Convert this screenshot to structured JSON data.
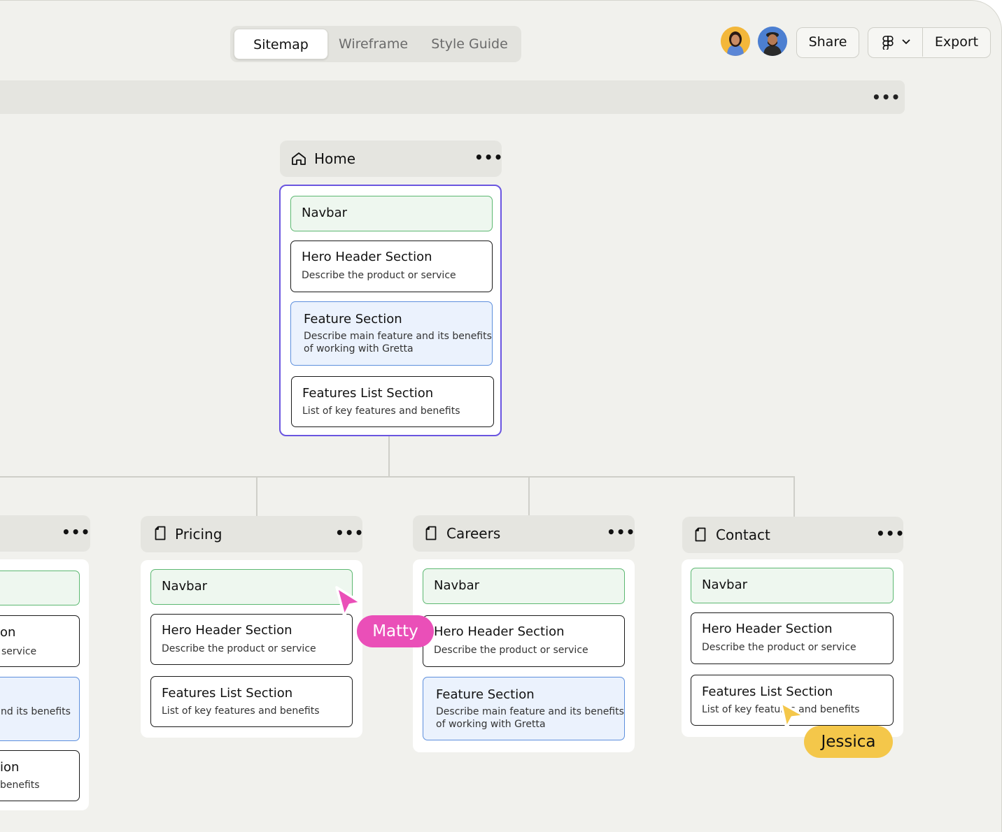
{
  "tabs": [
    "Sitemap",
    "Wireframe",
    "Style Guide"
  ],
  "header": {
    "share": "Share",
    "export": "Export"
  },
  "icons": {
    "home": "home-icon",
    "page": "page-icon",
    "figma": "figma-icon",
    "chevron": "chevron-down-icon",
    "more": "more-horizontal-icon"
  },
  "colors": {
    "navbar_border": "#5cb871",
    "feature_border": "#5d8fdd",
    "selected_border": "#6a55e0",
    "matty": "#ea4fb8",
    "jessica": "#f4c74a"
  },
  "home": {
    "title": "Home",
    "sections": [
      {
        "title": "Navbar",
        "desc": ""
      },
      {
        "title": "Hero Header Section",
        "desc": "Describe the product or service"
      },
      {
        "title": "Feature Section",
        "desc1": "Describe main feature and its benefits",
        "desc2": "of working with Gretta"
      },
      {
        "title": "Features List Section",
        "desc": "List of key features and benefits"
      }
    ]
  },
  "left_partial": {
    "texts": [
      "on",
      "service",
      "nd its benefits",
      "ion",
      "benefits"
    ]
  },
  "pricing": {
    "title": "Pricing",
    "sections": [
      {
        "title": "Navbar"
      },
      {
        "title": "Hero Header Section",
        "desc": "Describe the product or service"
      },
      {
        "title": "Features List Section",
        "desc": "List of key features and benefits"
      }
    ]
  },
  "careers": {
    "title": "Careers",
    "sections": [
      {
        "title": "Navbar"
      },
      {
        "title": "Hero Header Section",
        "desc": "Describe the product or service"
      },
      {
        "title": "Feature Section",
        "desc1": "Describe main feature and its benefits",
        "desc2": "of working with Gretta"
      }
    ]
  },
  "contact": {
    "title": "Contact",
    "sections": [
      {
        "title": "Navbar"
      },
      {
        "title": "Hero Header Section",
        "desc": "Describe the product or service"
      },
      {
        "title": "Features List Section",
        "desc": "List of key features and benefits"
      }
    ]
  },
  "cursors": {
    "matty": "Matty",
    "jessica": "Jessica"
  },
  "more": "•••"
}
